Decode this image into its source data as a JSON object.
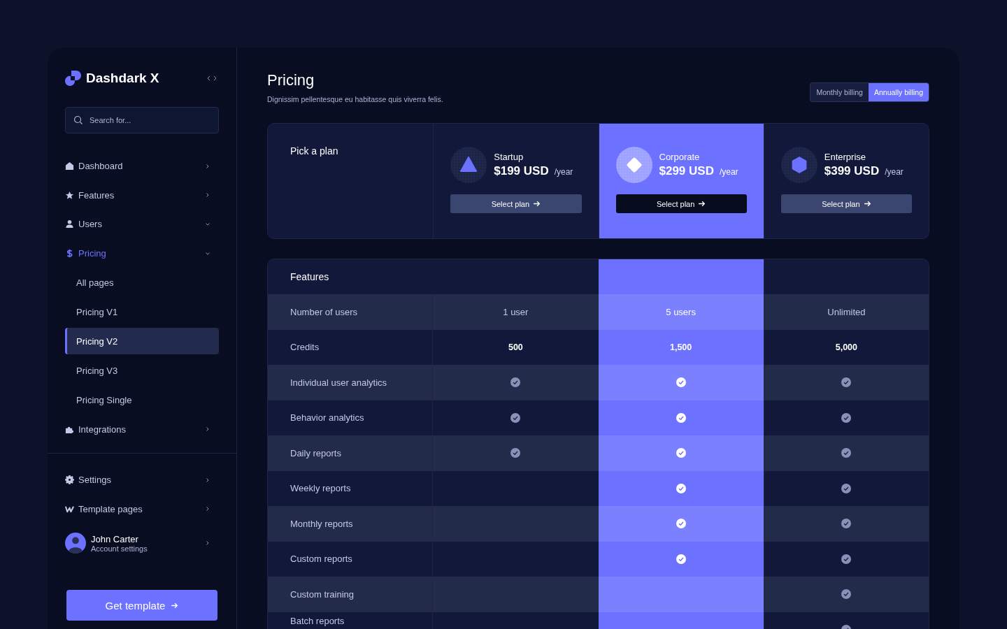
{
  "brand": {
    "name": "Dashdark X"
  },
  "search": {
    "placeholder": "Search for..."
  },
  "nav": [
    {
      "label": "Dashboard",
      "expanded": false,
      "selected": false
    },
    {
      "label": "Features",
      "expanded": false,
      "selected": false
    },
    {
      "label": "Users",
      "expanded": true,
      "selected": false
    },
    {
      "label": "Pricing",
      "expanded": true,
      "selected": true,
      "children": [
        {
          "label": "All pages",
          "selected": false
        },
        {
          "label": "Pricing V1",
          "selected": false
        },
        {
          "label": "Pricing V2",
          "selected": true
        },
        {
          "label": "Pricing V3",
          "selected": false
        },
        {
          "label": "Pricing Single",
          "selected": false
        }
      ]
    },
    {
      "label": "Integrations",
      "expanded": false,
      "selected": false
    }
  ],
  "nav_bottom": [
    {
      "label": "Settings",
      "expanded": false,
      "selected": false
    },
    {
      "label": "Template pages",
      "expanded": false,
      "selected": false
    }
  ],
  "account": {
    "name": "John Carter",
    "subtitle": "Account settings"
  },
  "cta": {
    "label": "Get template"
  },
  "page": {
    "title": "Pricing",
    "subtitle": "Dignissim pellentesque eu habitasse quis viverra felis."
  },
  "billing": [
    {
      "label": "Monthly billing",
      "selected": false
    },
    {
      "label": "Annually billing",
      "selected": true
    }
  ],
  "plans_heading": "Pick a plan",
  "plans": [
    {
      "name": "Startup",
      "price": "$199 USD",
      "period": "/year",
      "button": "Select plan",
      "selected": false
    },
    {
      "name": "Corporate",
      "price": "$299 USD",
      "period": "/year",
      "button": "Select plan",
      "selected": true
    },
    {
      "name": "Enterprise",
      "price": "$399 USD",
      "period": "/year",
      "button": "Select plan",
      "selected": false
    }
  ],
  "features_heading": "Features",
  "features": [
    {
      "name": "Number of users",
      "kind": "text",
      "values": [
        "1 user",
        "5 users",
        "Unlimited"
      ]
    },
    {
      "name": "Credits",
      "kind": "number",
      "values": [
        "500",
        "1,500",
        "5,000"
      ]
    },
    {
      "name": "Individual user analytics",
      "kind": "check",
      "checks": [
        true,
        true,
        true
      ]
    },
    {
      "name": "Behavior analytics",
      "kind": "check",
      "checks": [
        true,
        true,
        true
      ]
    },
    {
      "name": "Daily reports",
      "kind": "check",
      "checks": [
        true,
        true,
        true
      ]
    },
    {
      "name": "Weekly reports",
      "kind": "check",
      "checks": [
        false,
        true,
        true
      ]
    },
    {
      "name": "Monthly reports",
      "kind": "check",
      "checks": [
        false,
        true,
        true
      ]
    },
    {
      "name": "Custom reports",
      "kind": "check",
      "checks": [
        false,
        true,
        true
      ]
    },
    {
      "name": "Custom training",
      "kind": "check",
      "checks": [
        false,
        false,
        true
      ]
    },
    {
      "name": "Batch reports",
      "kind": "check",
      "checks": [
        false,
        false,
        true
      ]
    }
  ]
}
